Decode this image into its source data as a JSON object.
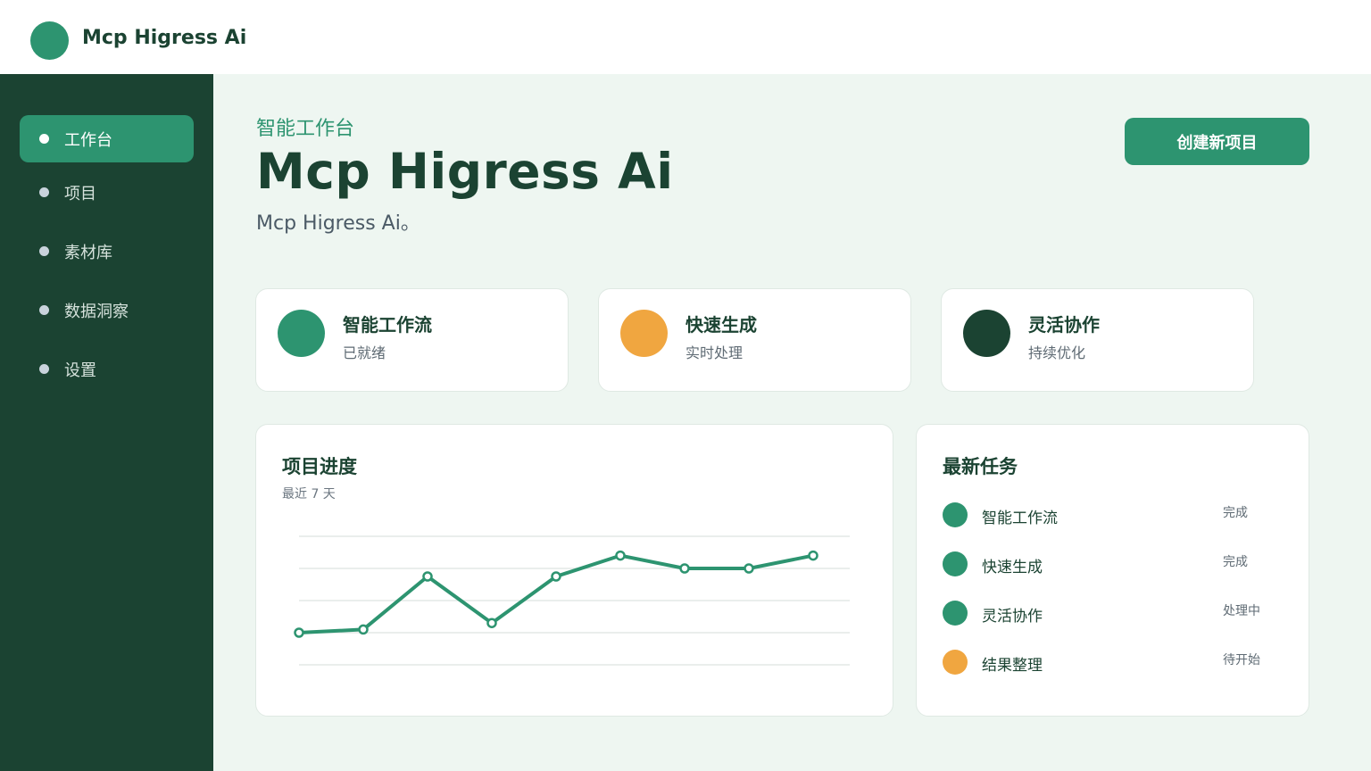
{
  "app": {
    "name": "Mcp Higress Ai"
  },
  "sidebar": {
    "items": [
      {
        "label": "工作台",
        "active": true
      },
      {
        "label": "项目",
        "active": false
      },
      {
        "label": "素材库",
        "active": false
      },
      {
        "label": "数据洞察",
        "active": false
      },
      {
        "label": "设置",
        "active": false
      }
    ]
  },
  "header": {
    "eyebrow": "智能工作台",
    "title": "Mcp Higress Ai",
    "subtitle": "Mcp Higress Ai。",
    "create_button": "创建新项目"
  },
  "stats": [
    {
      "title": "智能工作流",
      "sub": "已就绪",
      "color": "#2d9470"
    },
    {
      "title": "快速生成",
      "sub": "实时处理",
      "color": "#f0a640"
    },
    {
      "title": "灵活协作",
      "sub": "持续优化",
      "color": "#1b4332"
    }
  ],
  "progress": {
    "title": "项目进度",
    "subtitle": "最近 7 天"
  },
  "tasks": {
    "title": "最新任务",
    "items": [
      {
        "name": "智能工作流",
        "status": "完成",
        "color": "#2d9470"
      },
      {
        "name": "快速生成",
        "status": "完成",
        "color": "#2d9470"
      },
      {
        "name": "灵活协作",
        "status": "处理中",
        "color": "#2d9470"
      },
      {
        "name": "结果整理",
        "status": "待开始",
        "color": "#f0a640"
      }
    ]
  },
  "colors": {
    "primary": "#2d9470",
    "dark": "#1b4332",
    "accent": "#f0a640",
    "background": "#eef6f1"
  },
  "chart_data": {
    "type": "line",
    "x": [
      1,
      2,
      3,
      4,
      5,
      6,
      7,
      8,
      9
    ],
    "values": [
      3,
      3.1,
      4.75,
      3.3,
      4.75,
      5.4,
      5,
      5,
      5.4
    ],
    "ylim": [
      0,
      6
    ],
    "grid": true,
    "color": "#2d9470"
  }
}
